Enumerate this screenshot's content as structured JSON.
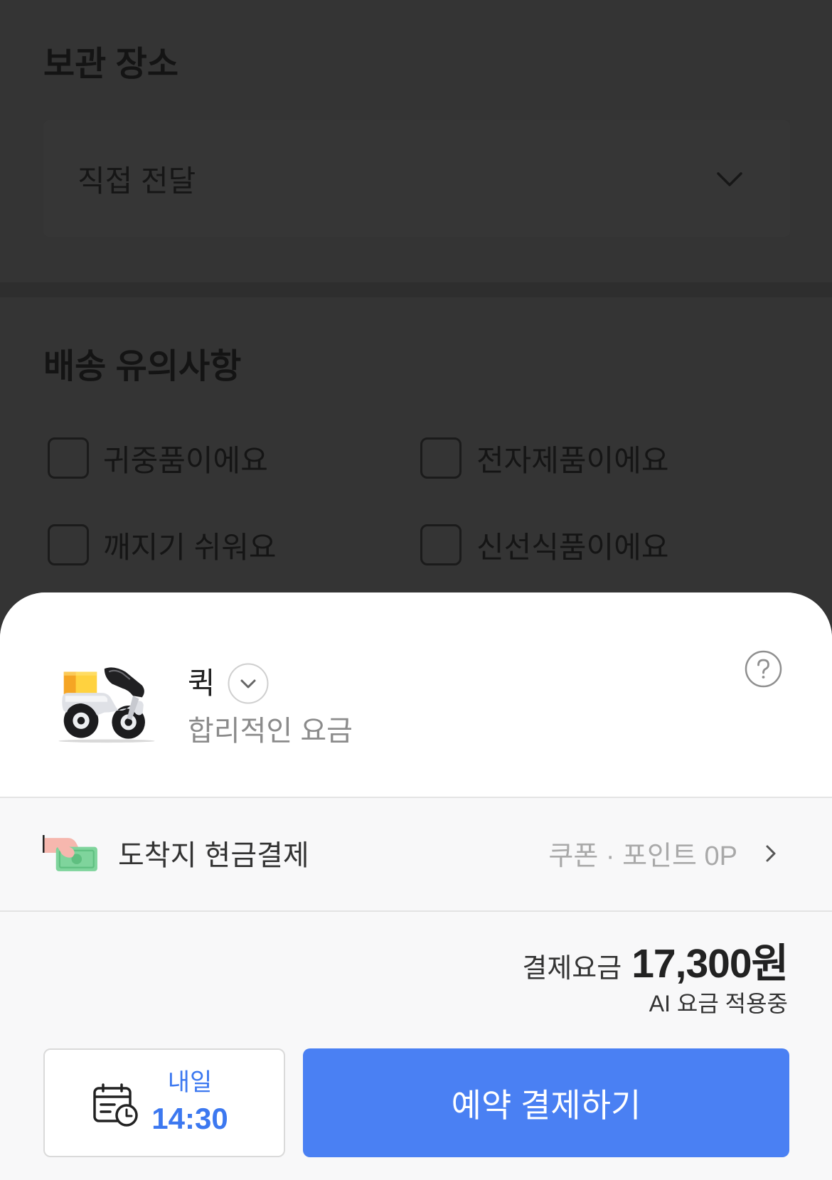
{
  "background_page": {
    "storage_section": {
      "title": "보관 장소",
      "selected_value": "직접 전달"
    },
    "notes_section": {
      "title": "배송 유의사항",
      "options": [
        {
          "label": "귀중품이에요",
          "checked": false
        },
        {
          "label": "전자제품이에요",
          "checked": false
        },
        {
          "label": "깨지기 쉬워요",
          "checked": false
        },
        {
          "label": "신선식품이에요",
          "checked": false
        }
      ]
    }
  },
  "sheet": {
    "service": {
      "name": "퀵",
      "description": "합리적인 요금"
    },
    "payment": {
      "method": "도착지 현금결제",
      "discount": "쿠폰 · 포인트 0P"
    },
    "fare": {
      "label": "결제요금",
      "amount": "17,300원",
      "note": "AI 요금 적용중"
    },
    "schedule": {
      "day": "내일",
      "time": "14:30"
    },
    "pay_button_label": "예약 결제하기"
  },
  "icons": {
    "dropdown": "chevron-down-icon",
    "service": "scooter-icon",
    "service_toggle": "circle-chevron-down-icon",
    "help": "question-circle-icon",
    "payment": "cash-hand-icon",
    "payment_more": "chevron-right-icon",
    "schedule": "calendar-clock-icon"
  },
  "colors": {
    "accent": "#4a80f3",
    "schedule_text": "#3c78f0",
    "dim_overlay": "#343434",
    "sheet_background": "#ffffff",
    "sheet_footer_background": "#f8f8f9"
  }
}
